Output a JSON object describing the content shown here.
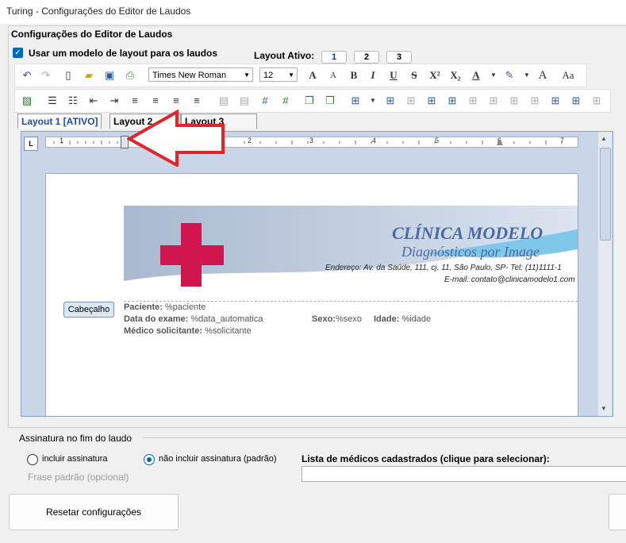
{
  "window": {
    "title": "Turing - Configurações do Editor de Laudos"
  },
  "group": {
    "title": "Configurações do Editor de Laudos"
  },
  "use_layout": {
    "label": "Usar um modelo de layout para os laudos",
    "checked": true
  },
  "active_layout": {
    "label": "Layout Ativo:",
    "buttons": [
      "1",
      "2",
      "3"
    ]
  },
  "toolbar": {
    "font_family": "Times New Roman",
    "font_size": "12",
    "text_buttons": [
      "A",
      "A",
      "B",
      "I",
      "U",
      "S",
      "X²",
      "X₂",
      "A",
      "A",
      "Aa"
    ]
  },
  "tabs": [
    "Layout 1 [ATIVO]",
    "Layout 2",
    "Layout 3"
  ],
  "ruler": {
    "numbers": [
      "1",
      "2",
      "3",
      "4",
      "5",
      "6",
      "7"
    ]
  },
  "document": {
    "clinic_name": "CLÍNICA MODELO",
    "clinic_subtitle": "Diagnósticos por Image",
    "address": "Endereço: Av. da Saúde, 111, cj. 11, São Paulo, SP- Tel: (11)1111-1",
    "email": "E-mail: contato@clinicamodelo1.com",
    "header_tag": "Cabeçalho",
    "fields": {
      "patient_label": "Paciente:",
      "patient_value": "%paciente",
      "exam_date_label": "Data do exame:",
      "exam_date_value": "%data_automatica",
      "sex_label": "Sexo:",
      "sex_value": "%sexo",
      "age_label": "Idade:",
      "age_value": "%idade",
      "doctor_label": "Médico solicitante:",
      "doctor_value": "%solicitante"
    }
  },
  "signature": {
    "title": "Assinatura no fim do laudo",
    "options": [
      "incluir assinatura",
      "não incluir assinatura (padrão)"
    ],
    "selected": 1,
    "phrase_label": "Frase padrão (opcional)"
  },
  "doctors_list": {
    "title": "Lista de médicos cadastrados (clique para selecionar):"
  },
  "buttons": {
    "reset": "Resetar configurações"
  },
  "colors": {
    "accent": "#0067c0",
    "cross": "#d1164f",
    "clinic_text": "#4a6aa0",
    "arrow": "#e0262b"
  }
}
